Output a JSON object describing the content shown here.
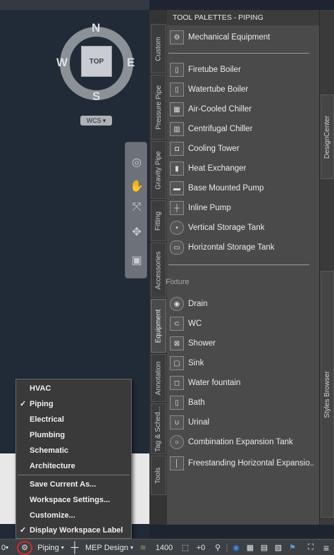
{
  "viewcube": {
    "north": "N",
    "south": "S",
    "east": "E",
    "west": "W",
    "face": "TOP",
    "wcs": "WCS"
  },
  "tabs": [
    "Custom",
    "Pressure Pipe",
    "Gravity Pipe",
    "Fitting",
    "Accessories",
    "Equipment",
    "Annotation",
    "Tag & Sched...",
    "Tools"
  ],
  "palette": {
    "title": "TOOL PALETTES - PIPING",
    "items": [
      "Mechanical Equipment",
      "Firetube Boiler",
      "Watertube Boiler",
      "Air-Cooled Chiller",
      "Centrifugal Chiller",
      "Cooling Tower",
      "Heat Exchanger",
      "Base Mounted Pump",
      "Inline Pump",
      "Vertical Storage Tank",
      "Horizontal Storage Tank"
    ],
    "fixture_section": "Fixture",
    "fixtures": [
      "Drain",
      "WC",
      "Shower",
      "Sink",
      "Water fountain",
      "Bath",
      "Urinal",
      "Combination Expansion Tank",
      "Freestanding  Horizontal  Expansio..."
    ]
  },
  "right_tabs": [
    "DesignCenter",
    "Styles Browser"
  ],
  "menu": {
    "workspaces": [
      "HVAC",
      "Piping",
      "Electrical",
      "Plumbing",
      "Schematic",
      "Architecture"
    ],
    "selected": "Piping",
    "actions": [
      "Save Current As...",
      "Workspace Settings...",
      "Customize...",
      "Display Workspace Label"
    ],
    "display_label_checked": "✓",
    "piping_check": "✓"
  },
  "statusbar": {
    "left_num": "0",
    "workspace": "Piping",
    "config": "MEP Design",
    "scale": "1400",
    "plus_value": "+0"
  },
  "colors": {
    "highlight_circle": "#d42b2b",
    "palette_bg": "#4a4a4a",
    "viewport_bg": "#212a37"
  }
}
